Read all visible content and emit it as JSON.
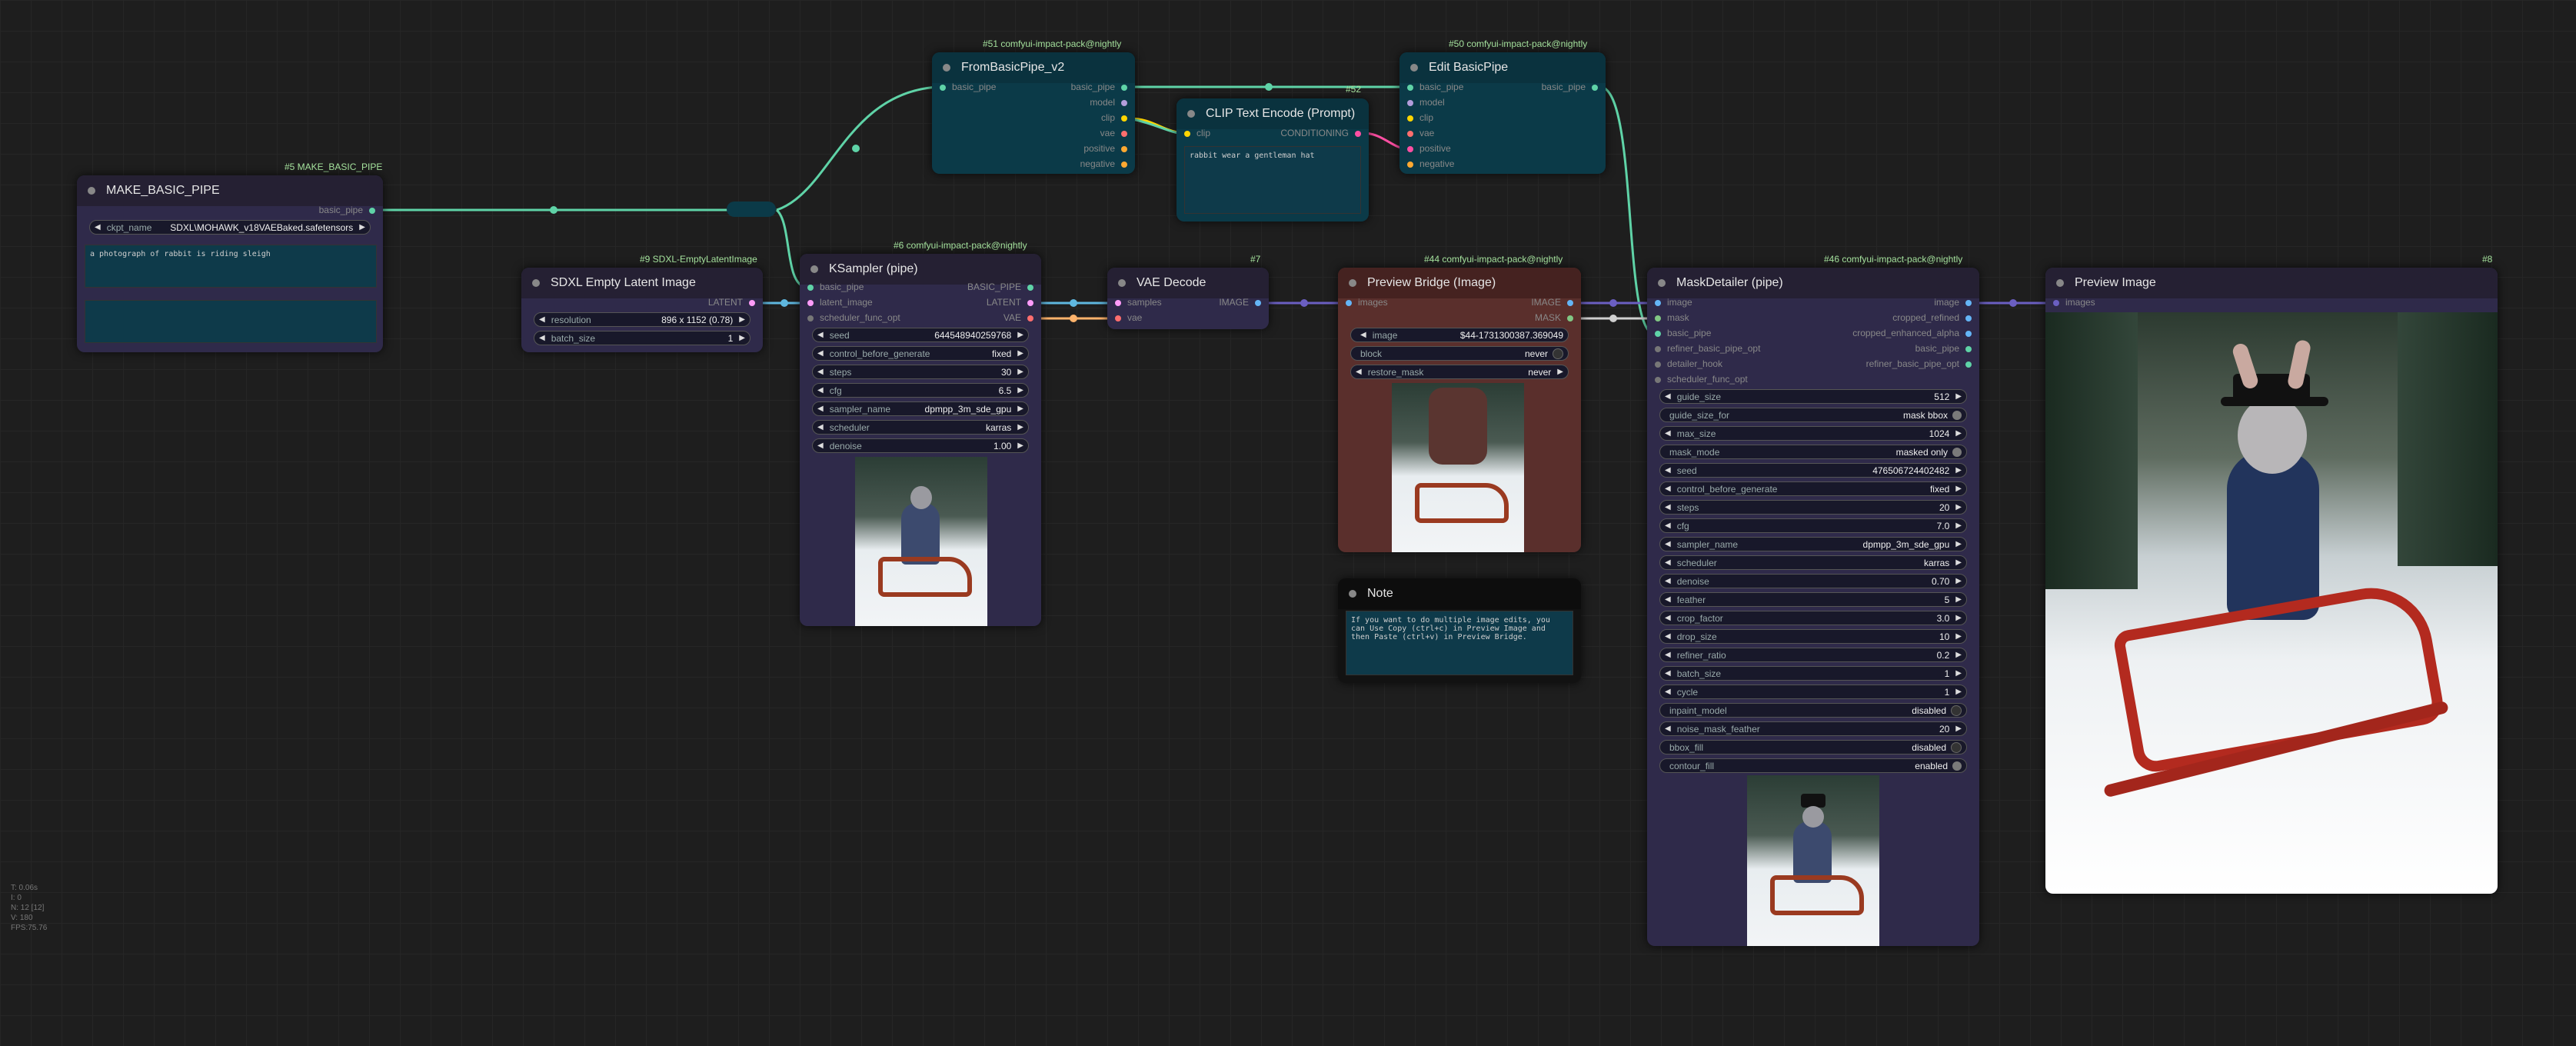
{
  "nodes": {
    "make_basic_pipe": {
      "badge": "#5 MAKE_BASIC_PIPE",
      "title": "MAKE_BASIC_PIPE",
      "out_label": "basic_pipe",
      "ckpt_label": "ckpt_name",
      "ckpt_value": "SDXL\\MOHAWK_v18VAEBaked.safetensors",
      "prompt": "a photograph of rabbit is riding sleigh"
    },
    "empty_latent": {
      "badge": "#9 SDXL-EmptyLatentImage",
      "title": "SDXL Empty Latent Image",
      "out_label": "LATENT",
      "widgets": [
        {
          "label": "resolution",
          "value": "896 x 1152 (0.78)"
        },
        {
          "label": "batch_size",
          "value": "1"
        }
      ]
    },
    "ksampler": {
      "badge": "#6 comfyui-impact-pack@nightly",
      "title": "KSampler (pipe)",
      "inputs": [
        "basic_pipe",
        "latent_image",
        "scheduler_func_opt"
      ],
      "outputs": [
        "BASIC_PIPE",
        "LATENT",
        "VAE"
      ],
      "widgets": [
        {
          "label": "seed",
          "value": "644548940259768"
        },
        {
          "label": "control_before_generate",
          "value": "fixed"
        },
        {
          "label": "steps",
          "value": "30"
        },
        {
          "label": "cfg",
          "value": "6.5"
        },
        {
          "label": "sampler_name",
          "value": "dpmpp_3m_sde_gpu"
        },
        {
          "label": "scheduler",
          "value": "karras"
        },
        {
          "label": "denoise",
          "value": "1.00"
        }
      ]
    },
    "from_basic_pipe": {
      "badge": "#51 comfyui-impact-pack@nightly",
      "title": "FromBasicPipe_v2",
      "inputs": [
        "basic_pipe"
      ],
      "outputs": [
        "basic_pipe",
        "model",
        "clip",
        "vae",
        "positive",
        "negative"
      ]
    },
    "clip_encode": {
      "title": "CLIP Text Encode (Prompt)",
      "input": "clip",
      "output": "CONDITIONING",
      "text": "rabbit wear a gentleman hat"
    },
    "edit_pipe": {
      "badge": "#50 comfyui-impact-pack@nightly",
      "title": "Edit BasicPipe",
      "inputs": [
        "basic_pipe",
        "model",
        "clip",
        "vae",
        "positive",
        "negative"
      ],
      "outputs": [
        "basic_pipe"
      ],
      "reroute_badge": "#52"
    },
    "vae_decode": {
      "badge": "#7",
      "title": "VAE Decode",
      "inputs": [
        "samples",
        "vae"
      ],
      "outputs": [
        "IMAGE"
      ]
    },
    "preview_bridge": {
      "badge": "#44 comfyui-impact-pack@nightly",
      "title": "Preview Bridge (Image)",
      "inputs": [
        "images"
      ],
      "outputs": [
        "IMAGE",
        "MASK"
      ],
      "widgets": [
        {
          "label": "image",
          "value": "$44-1731300387.369049"
        },
        {
          "label": "block",
          "value": "never"
        },
        {
          "label": "restore_mask",
          "value": "never"
        }
      ]
    },
    "note": {
      "title": "Note",
      "text": "If you want to do multiple image edits, you can Use Copy (ctrl+c) in Preview Image and then Paste (ctrl+v) in Preview Bridge."
    },
    "mask_detailer": {
      "badge": "#46 comfyui-impact-pack@nightly",
      "title": "MaskDetailer (pipe)",
      "inputs": [
        "image",
        "mask",
        "basic_pipe",
        "refiner_basic_pipe_opt",
        "detailer_hook",
        "scheduler_func_opt"
      ],
      "outputs": [
        "image",
        "cropped_refined",
        "cropped_enhanced_alpha",
        "basic_pipe",
        "refiner_basic_pipe_opt"
      ],
      "widgets": [
        {
          "label": "guide_size",
          "value": "512"
        },
        {
          "label": "guide_size_for",
          "value": "mask bbox",
          "toggle": true
        },
        {
          "label": "max_size",
          "value": "1024"
        },
        {
          "label": "mask_mode",
          "value": "masked only",
          "toggle": true
        },
        {
          "label": "seed",
          "value": "476506724402482"
        },
        {
          "label": "control_before_generate",
          "value": "fixed"
        },
        {
          "label": "steps",
          "value": "20"
        },
        {
          "label": "cfg",
          "value": "7.0"
        },
        {
          "label": "sampler_name",
          "value": "dpmpp_3m_sde_gpu"
        },
        {
          "label": "scheduler",
          "value": "karras"
        },
        {
          "label": "denoise",
          "value": "0.70"
        },
        {
          "label": "feather",
          "value": "5"
        },
        {
          "label": "crop_factor",
          "value": "3.0"
        },
        {
          "label": "drop_size",
          "value": "10"
        },
        {
          "label": "refiner_ratio",
          "value": "0.2"
        },
        {
          "label": "batch_size",
          "value": "1"
        },
        {
          "label": "cycle",
          "value": "1"
        },
        {
          "label": "inpaint_model",
          "value": "disabled",
          "toggle": true,
          "off": true
        },
        {
          "label": "noise_mask_feather",
          "value": "20"
        },
        {
          "label": "bbox_fill",
          "value": "disabled",
          "toggle": true,
          "off": true
        },
        {
          "label": "contour_fill",
          "value": "enabled",
          "toggle": true
        }
      ]
    },
    "preview_image": {
      "badge": "#8",
      "title": "Preview Image",
      "input": "images"
    }
  },
  "stats": [
    "T: 0.06s",
    "I: 0",
    "N: 12 [12]",
    "V: 180",
    "FPS:75.76"
  ],
  "colors": {
    "basic_pipe": "#5fd3a7",
    "latent": "#ff9cf9",
    "vae": "#ff6e6e",
    "image": "#64b5f6",
    "mask": "#81c784",
    "clip": "#ffd500",
    "conditioning": "#ffa931"
  }
}
